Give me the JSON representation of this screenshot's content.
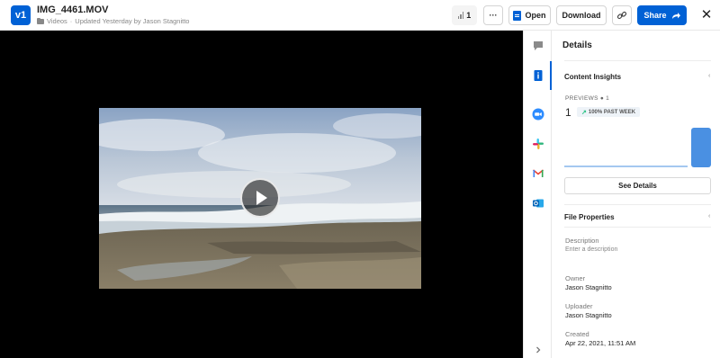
{
  "header": {
    "version_badge": "v1",
    "file_name": "IMG_4461.MOV",
    "folder": "Videos",
    "separator": "·",
    "updated": "Updated Yesterday by Jason Stagnitto",
    "view_count": "1",
    "more_label": "···",
    "open_label": "Open",
    "download_label": "Download",
    "share_label": "Share",
    "close_label": "✕"
  },
  "sidebar_rail": {
    "icons": [
      "comments-icon",
      "details-icon",
      "zoom-icon",
      "slack-icon",
      "gmail-icon",
      "outlook-icon",
      "chevron-right-icon"
    ]
  },
  "details": {
    "title": "Details",
    "insights": {
      "heading": "Content Insights",
      "previews_label": "PREVIEWS",
      "previews_sub": "● 1",
      "count": "1",
      "trend": "100% PAST WEEK",
      "trend_arrow": "↗",
      "chart_values": [
        0,
        0,
        0,
        0,
        0,
        0,
        1
      ],
      "see_details": "See Details"
    },
    "file_properties": {
      "heading": "File Properties",
      "description_label": "Description",
      "description_placeholder": "Enter a description",
      "owner_label": "Owner",
      "owner_value": "Jason Stagnitto",
      "uploader_label": "Uploader",
      "uploader_value": "Jason Stagnitto",
      "created_label": "Created",
      "created_value": "Apr 22, 2021, 11:51 AM"
    }
  },
  "colors": {
    "brand_blue": "#0061d5",
    "chart_blue": "#4a90e2"
  }
}
